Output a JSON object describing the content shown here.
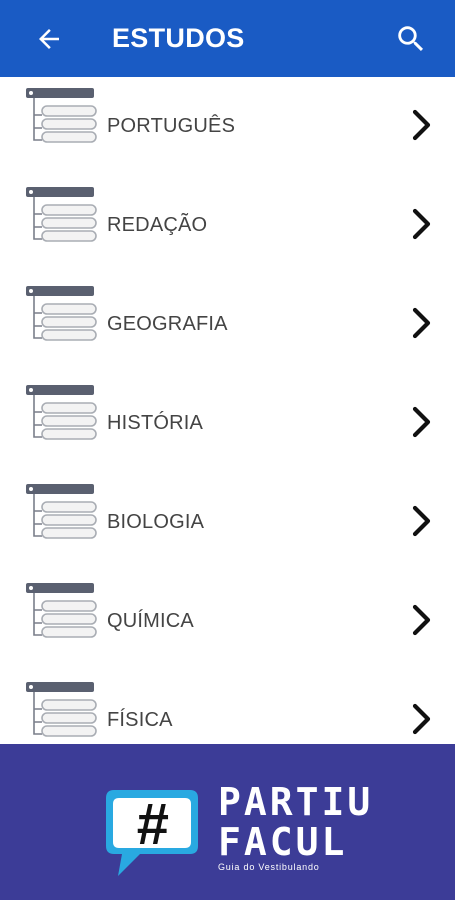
{
  "header": {
    "title": "ESTUDOS",
    "back_icon": "arrow-left-icon",
    "search_icon": "search-icon",
    "background": "#1a5bc4"
  },
  "subjects": [
    {
      "label": "PORTUGUÊS"
    },
    {
      "label": "REDAÇÃO"
    },
    {
      "label": "GEOGRAFIA"
    },
    {
      "label": "HISTÓRIA"
    },
    {
      "label": "BIOLOGIA"
    },
    {
      "label": "QUÍMICA"
    },
    {
      "label": "FÍSICA"
    }
  ],
  "item_icon": "list-tree-icon",
  "chevron_icon": "chevron-right-icon",
  "banner": {
    "background": "#3c3c97",
    "logo_symbol": "#",
    "brand_line1": "PARTIU",
    "brand_line2": "FACUL",
    "tagline": "Guia do Vestibulando"
  }
}
